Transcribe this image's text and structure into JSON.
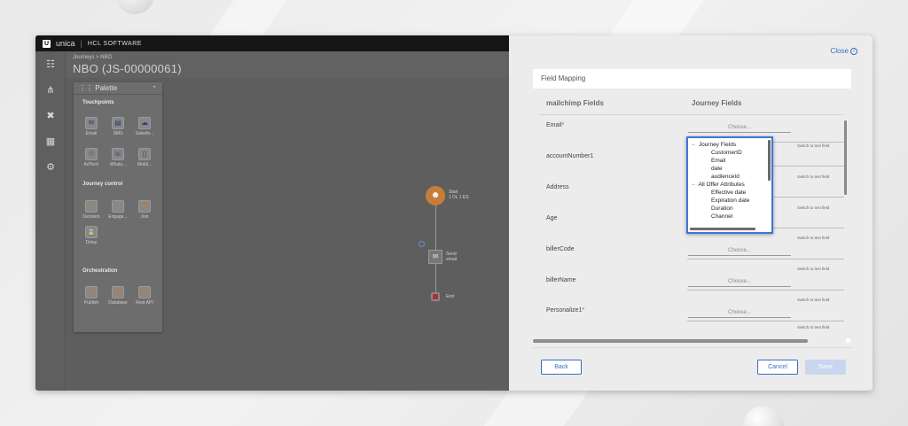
{
  "app": {
    "brand": "unica",
    "brand_letter": "U",
    "vendor": "HCL SOFTWARE"
  },
  "journey": {
    "breadcrumb": "Journeys > NBO",
    "title": "NBO (JS-00000061)"
  },
  "palette": {
    "title": "Palette",
    "sections": {
      "touchpoints": "Touchpoints",
      "journey_control": "Journey control",
      "orchestration": "Orchestration"
    },
    "items": {
      "email": "Email",
      "sms": "SMS",
      "salesforce": "Salesfo...",
      "adtech": "AdTech",
      "whatsapp": "Whats...",
      "mobile": "Mobil...",
      "decision": "Decision",
      "engagement": "Engage...",
      "join": "Join",
      "delay": "Delay",
      "publish": "Publish",
      "database": "Database",
      "rest_api": "Rest API"
    }
  },
  "flow": {
    "start_label": "Start",
    "start_sub": "1 DL 1 ES",
    "email_label": "Send",
    "email_sub": "email",
    "end_label": "End"
  },
  "modal": {
    "close": "Close",
    "section_title": "Field Mapping",
    "col_left": "mailchimp Fields",
    "col_right": "Journey Fields",
    "switch_text": "Switch to text field",
    "fields": [
      {
        "name": "Email",
        "required": "*",
        "value": "Choose..."
      },
      {
        "name": "accountNumber1",
        "required": "",
        "value": "Choose..."
      },
      {
        "name": "Address",
        "required": "",
        "value": "Choose..."
      },
      {
        "name": "Age",
        "required": "",
        "value": "Choose..."
      },
      {
        "name": "billerCode",
        "required": "",
        "value": "Choose..."
      },
      {
        "name": "billerName",
        "required": "",
        "value": "Choose..."
      },
      {
        "name": "Personalize1",
        "required": "*",
        "value": "Choose..."
      }
    ],
    "dropdown": {
      "group1": "Journey Fields",
      "group1_items": [
        "CustomerID",
        "Email",
        "date",
        "audienceId"
      ],
      "group2": "All Offer Attributes",
      "group2_items": [
        "Effective date",
        "Expiration date",
        "Duration",
        "Channel"
      ]
    },
    "buttons": {
      "back": "Back",
      "cancel": "Cancel",
      "save": "Save"
    }
  },
  "colors": {
    "accent": "#3a6dbf",
    "dropdown_border": "#3b76d6",
    "start_node": "#c77d3a"
  }
}
